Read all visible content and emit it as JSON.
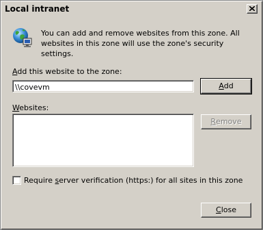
{
  "window": {
    "title": "Local intranet",
    "close_glyph": "close-icon"
  },
  "intro_text": "You can add and remove websites from this zone. All websites in this zone will use the zone's security settings.",
  "add_site": {
    "label_access_key": "A",
    "label_rest": "dd this website to the zone:",
    "value": "\\\\covevm",
    "button_access_key": "A",
    "button_rest": "dd"
  },
  "websites": {
    "label_access_key": "W",
    "label_rest": "ebsites:",
    "items": [],
    "remove_access_key": "R",
    "remove_rest": "emove"
  },
  "require_verification": {
    "label_before": "Require ",
    "label_access_key": "s",
    "label_after": "erver verification (https:) for all sites in this zone",
    "checked": false
  },
  "close_button": {
    "access_key": "C",
    "rest": "lose"
  },
  "icons": {
    "zone_icon": "globe-network-icon"
  }
}
